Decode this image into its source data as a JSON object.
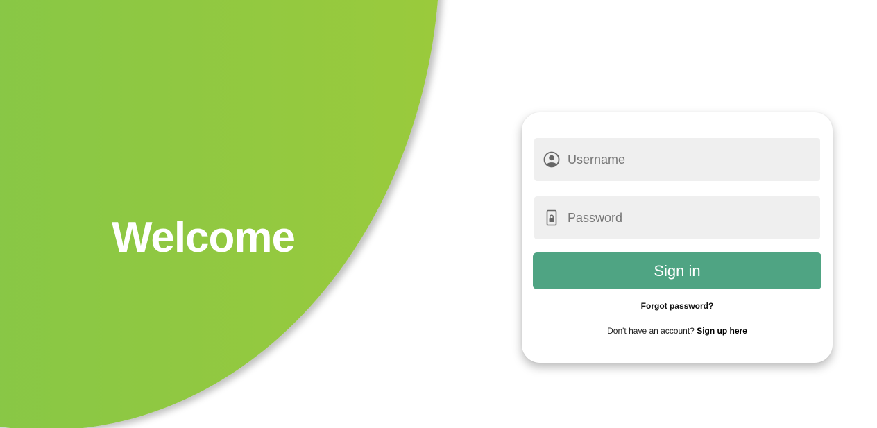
{
  "hero": {
    "title": "Welcome"
  },
  "login": {
    "username": {
      "value": "",
      "placeholder": "Username",
      "icon": "user-circle-icon"
    },
    "password": {
      "value": "",
      "placeholder": "Password",
      "icon": "lock-icon"
    },
    "submit_label": "Sign in",
    "forgot_label": "Forgot password?",
    "signup_prompt": "Don't have an account?",
    "signup_link": "Sign up here"
  },
  "colors": {
    "hero_gradient_start": "#7bc54d",
    "hero_gradient_end": "#9aca3c",
    "button": "#4fa483",
    "field_bg": "#efefef"
  }
}
